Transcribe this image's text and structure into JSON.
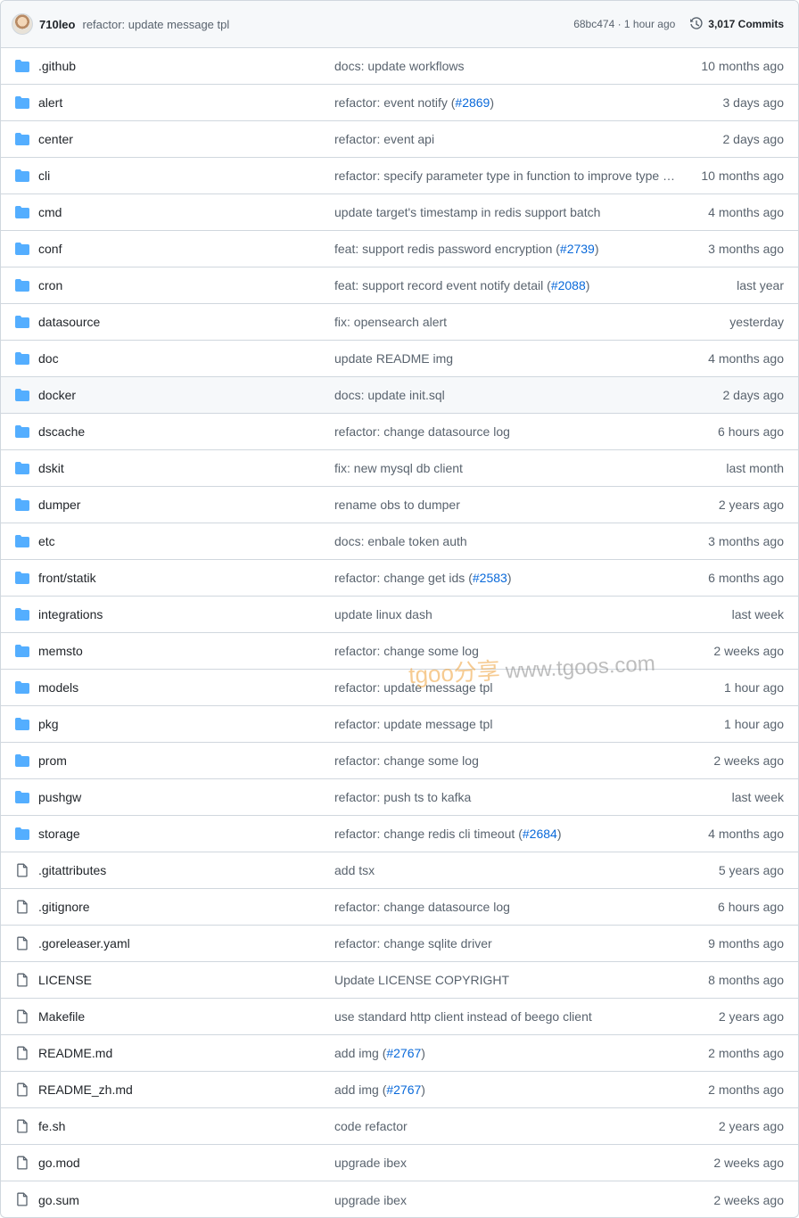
{
  "header": {
    "author": "710leo",
    "message": "refactor: update message tpl",
    "meta": "68bc474 · 1 hour ago",
    "commits_label": "3,017 Commits"
  },
  "watermark": {
    "brand": "tgoo分享",
    "site": "www.tgoos.com"
  },
  "colors": {
    "folder": "#54aeff",
    "link": "#0969da",
    "muted": "#59636e"
  },
  "files": [
    {
      "type": "dir",
      "name": ".github",
      "message": "docs: update workflows",
      "pr": "",
      "date": "10 months ago"
    },
    {
      "type": "dir",
      "name": "alert",
      "message": "refactor: event notify (",
      "pr": "#2869",
      "date": "3 days ago"
    },
    {
      "type": "dir",
      "name": "center",
      "message": "refactor: event api",
      "pr": "",
      "date": "2 days ago"
    },
    {
      "type": "dir",
      "name": "cli",
      "message": "refactor: specify parameter type in function to improve type …",
      "pr": "",
      "date": "10 months ago"
    },
    {
      "type": "dir",
      "name": "cmd",
      "message": "update target's timestamp in redis support batch",
      "pr": "",
      "date": "4 months ago"
    },
    {
      "type": "dir",
      "name": "conf",
      "message": "feat: support redis password encryption (",
      "pr": "#2739",
      "date": "3 months ago"
    },
    {
      "type": "dir",
      "name": "cron",
      "message": "feat: support record event notify detail (",
      "pr": "#2088",
      "date": "last year"
    },
    {
      "type": "dir",
      "name": "datasource",
      "message": "fix: opensearch alert",
      "pr": "",
      "date": "yesterday"
    },
    {
      "type": "dir",
      "name": "doc",
      "message": "update README img",
      "pr": "",
      "date": "4 months ago"
    },
    {
      "type": "dir",
      "name": "docker",
      "message": "docs: update init.sql",
      "pr": "",
      "date": "2 days ago",
      "hover": true
    },
    {
      "type": "dir",
      "name": "dscache",
      "message": "refactor: change datasource log",
      "pr": "",
      "date": "6 hours ago"
    },
    {
      "type": "dir",
      "name": "dskit",
      "message": "fix: new mysql db client",
      "pr": "",
      "date": "last month"
    },
    {
      "type": "dir",
      "name": "dumper",
      "message": "rename obs to dumper",
      "pr": "",
      "date": "2 years ago"
    },
    {
      "type": "dir",
      "name": "etc",
      "message": "docs: enbale token auth",
      "pr": "",
      "date": "3 months ago"
    },
    {
      "type": "dir",
      "name": "front/statik",
      "message": "refactor: change get ids (",
      "pr": "#2583",
      "date": "6 months ago"
    },
    {
      "type": "dir",
      "name": "integrations",
      "message": "update linux dash",
      "pr": "",
      "date": "last week"
    },
    {
      "type": "dir",
      "name": "memsto",
      "message": "refactor: change some log",
      "pr": "",
      "date": "2 weeks ago"
    },
    {
      "type": "dir",
      "name": "models",
      "message": "refactor: update message tpl",
      "pr": "",
      "date": "1 hour ago"
    },
    {
      "type": "dir",
      "name": "pkg",
      "message": "refactor: update message tpl",
      "pr": "",
      "date": "1 hour ago"
    },
    {
      "type": "dir",
      "name": "prom",
      "message": "refactor: change some log",
      "pr": "",
      "date": "2 weeks ago"
    },
    {
      "type": "dir",
      "name": "pushgw",
      "message": "refactor: push ts to kafka",
      "pr": "",
      "date": "last week"
    },
    {
      "type": "dir",
      "name": "storage",
      "message": "refactor: change redis cli timeout (",
      "pr": "#2684",
      "date": "4 months ago"
    },
    {
      "type": "file",
      "name": ".gitattributes",
      "message": "add tsx",
      "pr": "",
      "date": "5 years ago"
    },
    {
      "type": "file",
      "name": ".gitignore",
      "message": "refactor: change datasource log",
      "pr": "",
      "date": "6 hours ago"
    },
    {
      "type": "file",
      "name": ".goreleaser.yaml",
      "message": "refactor: change sqlite driver",
      "pr": "",
      "date": "9 months ago"
    },
    {
      "type": "file",
      "name": "LICENSE",
      "message": "Update LICENSE COPYRIGHT",
      "pr": "",
      "date": "8 months ago"
    },
    {
      "type": "file",
      "name": "Makefile",
      "message": "use standard http client instead of beego client",
      "pr": "",
      "date": "2 years ago"
    },
    {
      "type": "file",
      "name": "README.md",
      "message": "add img (",
      "pr": "#2767",
      "date": "2 months ago"
    },
    {
      "type": "file",
      "name": "README_zh.md",
      "message": "add img (",
      "pr": "#2767",
      "date": "2 months ago"
    },
    {
      "type": "file",
      "name": "fe.sh",
      "message": "code refactor",
      "pr": "",
      "date": "2 years ago"
    },
    {
      "type": "file",
      "name": "go.mod",
      "message": "upgrade ibex",
      "pr": "",
      "date": "2 weeks ago"
    },
    {
      "type": "file",
      "name": "go.sum",
      "message": "upgrade ibex",
      "pr": "",
      "date": "2 weeks ago"
    }
  ]
}
